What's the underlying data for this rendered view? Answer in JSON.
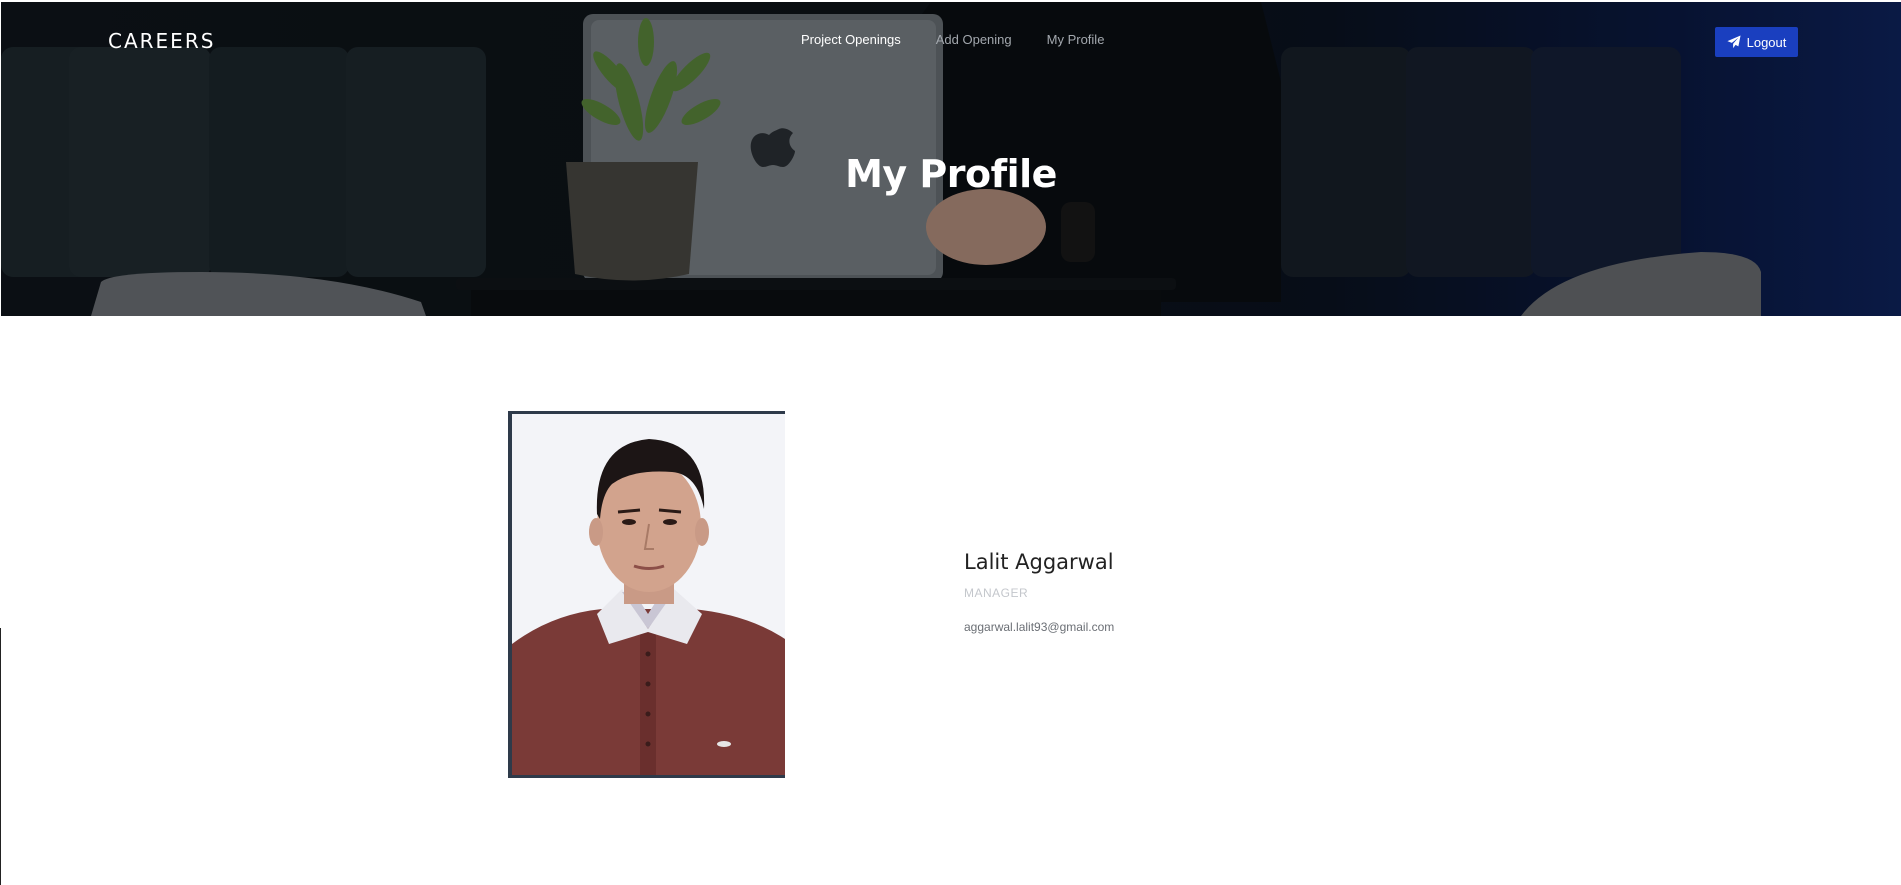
{
  "header": {
    "brand": "CAREERS",
    "nav": [
      {
        "label": "Project Openings",
        "active": true
      },
      {
        "label": "Add Opening",
        "active": false
      },
      {
        "label": "My Profile",
        "active": false
      }
    ],
    "logout_label": "Logout",
    "logout_icon": "paper-plane-icon",
    "accent_color": "#1a3fbf"
  },
  "hero": {
    "title": "My Profile"
  },
  "profile": {
    "name": "Lalit Aggarwal",
    "role": "MANAGER",
    "email": "aggarwal.lalit93@gmail.com"
  }
}
